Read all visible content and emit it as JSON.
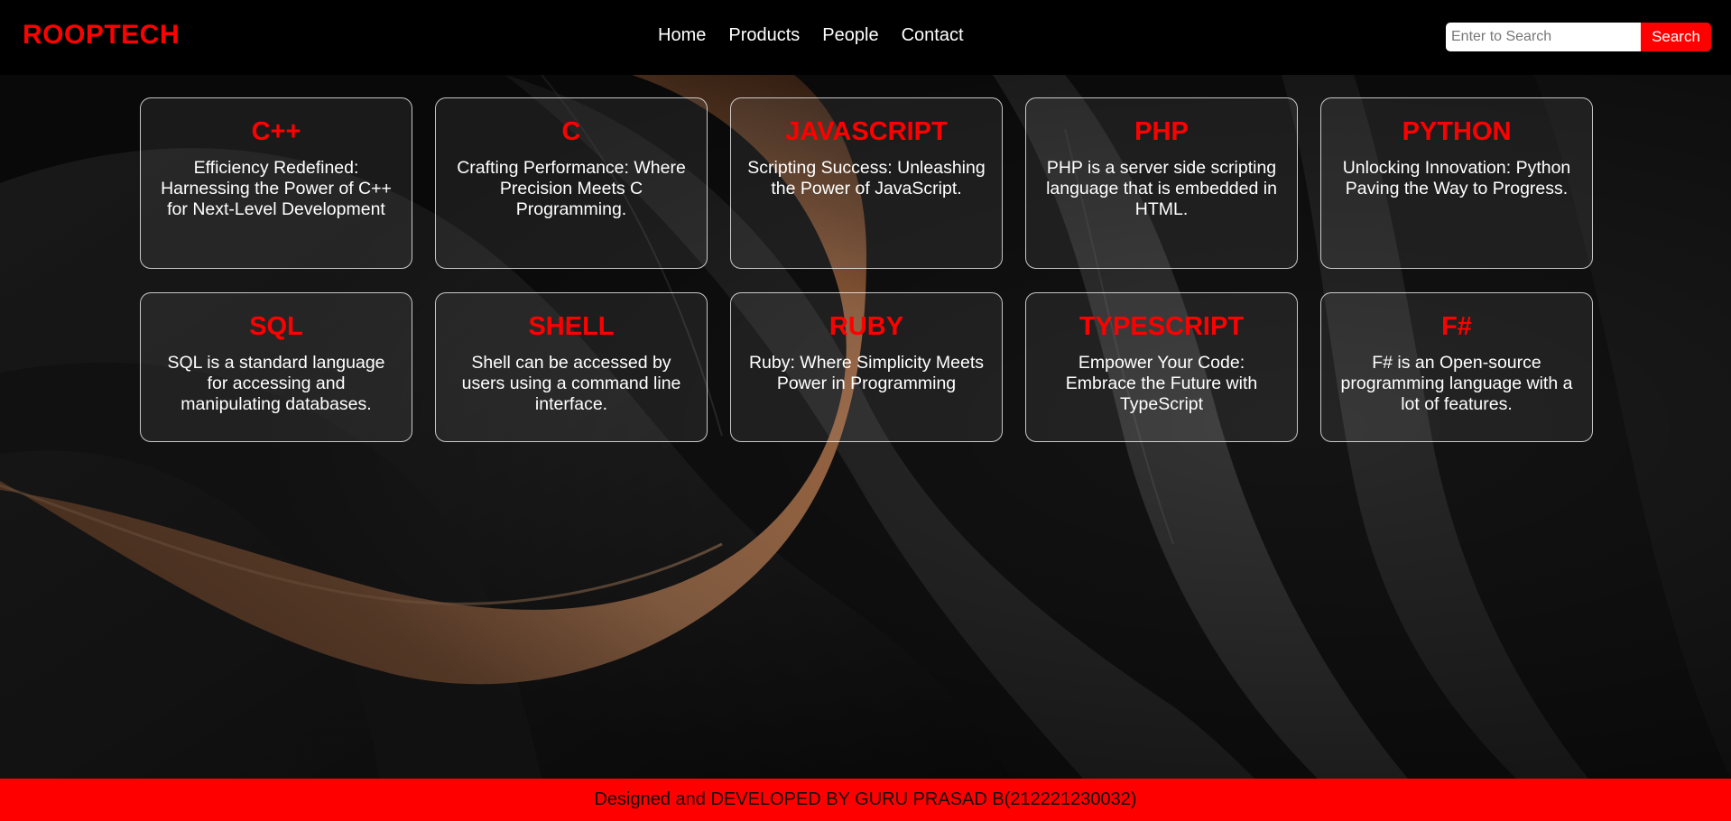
{
  "header": {
    "brand": "ROOPTECH",
    "nav": [
      {
        "label": "Home"
      },
      {
        "label": "Products"
      },
      {
        "label": "People"
      },
      {
        "label": "Contact"
      }
    ],
    "search": {
      "placeholder": "Enter to Search",
      "value": "",
      "button_label": "Search"
    }
  },
  "cards": [
    {
      "title": "C++",
      "description": "Efficiency Redefined: Harnessing the Power of C++ for Next-Level Development"
    },
    {
      "title": "C",
      "description": "Crafting Performance: Where Precision Meets C Programming."
    },
    {
      "title": "JAVASCRIPT",
      "description": "Scripting Success: Unleashing the Power of JavaScript."
    },
    {
      "title": "PHP",
      "description": "PHP is a server side scripting language that is embedded in HTML."
    },
    {
      "title": "PYTHON",
      "description": "Unlocking Innovation: Python Paving the Way to Progress."
    },
    {
      "title": "SQL",
      "description": "SQL is a standard language for accessing and manipulating databases."
    },
    {
      "title": "SHELL",
      "description": "Shell can be accessed by users using a command line interface."
    },
    {
      "title": "RUBY",
      "description": "Ruby: Where Simplicity Meets Power in Programming"
    },
    {
      "title": "TYPESCRIPT",
      "description": "Empower Your Code: Embrace the Future with TypeScript"
    },
    {
      "title": "F#",
      "description": "F# is an Open-source programming language with a lot of features."
    }
  ],
  "footer": {
    "text": "Designed and DEVELOPED BY GURU PRASAD B(212221230032)"
  },
  "colors": {
    "accent": "#ff0000",
    "background": "#000000",
    "text": "#ffffff",
    "hero_orange": "#c9855a"
  }
}
